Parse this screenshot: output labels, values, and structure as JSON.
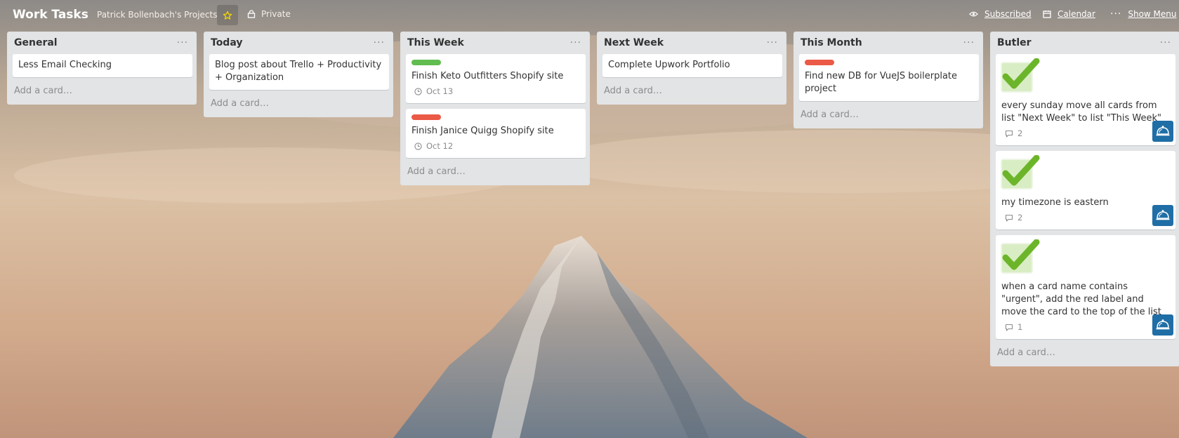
{
  "colors": {
    "label_green": "#61bd4f",
    "label_red": "#eb5a46",
    "list_bg": "#e2e4e6",
    "member_blue": "#1f6ea6",
    "star_yellow": "#f2d600"
  },
  "header": {
    "title": "Work Tasks",
    "team": "Patrick Bollenbach's Projects",
    "star_icon": "star-icon",
    "visibility": "Private",
    "subscribed": "Subscribed",
    "calendar": "Calendar",
    "show_menu": "Show Menu"
  },
  "lists": [
    {
      "name": "General",
      "cards": [
        {
          "title": "Less Email Checking"
        }
      ],
      "add_card": "Add a card…"
    },
    {
      "name": "Today",
      "cards": [
        {
          "title": "Blog post about Trello + Productivity + Organization"
        }
      ],
      "add_card": "Add a card…"
    },
    {
      "name": "This Week",
      "cards": [
        {
          "title": "Finish Keto Outfitters Shopify site",
          "label": "green",
          "due": "Oct 13"
        },
        {
          "title": "Finish Janice Quigg Shopify site",
          "label": "red",
          "due": "Oct 12"
        }
      ],
      "add_card": "Add a card…"
    },
    {
      "name": "Next Week",
      "cards": [
        {
          "title": "Complete Upwork Portfolio"
        }
      ],
      "add_card": "Add a card…"
    },
    {
      "name": "This Month",
      "cards": [
        {
          "title": "Find new DB for VueJS boilerplate project",
          "label": "red"
        }
      ],
      "add_card": "Add a card…"
    },
    {
      "name": "Butler",
      "cards": [
        {
          "title": "every sunday move all cards from list \"Next Week\" to list \"This Week\"",
          "comments": "2"
        },
        {
          "title": "my timezone is eastern",
          "comments": "2"
        },
        {
          "title": "when a card name contains \"urgent\", add the red label and move the card to the top of the list",
          "comments": "1"
        }
      ],
      "add_card": "Add a card…"
    }
  ]
}
